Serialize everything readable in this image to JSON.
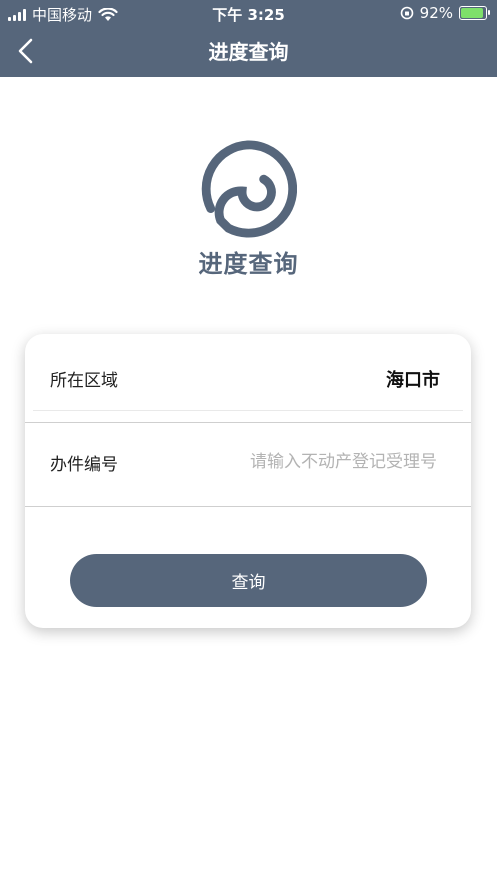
{
  "status_bar": {
    "carrier": "中国移动",
    "time": "下午 3:25",
    "battery": "92%"
  },
  "nav": {
    "title": "进度查询"
  },
  "brand": {
    "title": "进度查询"
  },
  "form": {
    "region_label": "所在区域",
    "region_value": "海口市",
    "case_label": "办件编号",
    "case_placeholder": "请输入不动产登记受理号",
    "case_value": "",
    "submit_label": "查询"
  },
  "colors": {
    "accent": "#56667b",
    "battery": "#7ee06a"
  },
  "icons": {
    "back": "chevron-left-icon",
    "logo": "spiral-logo-icon"
  }
}
